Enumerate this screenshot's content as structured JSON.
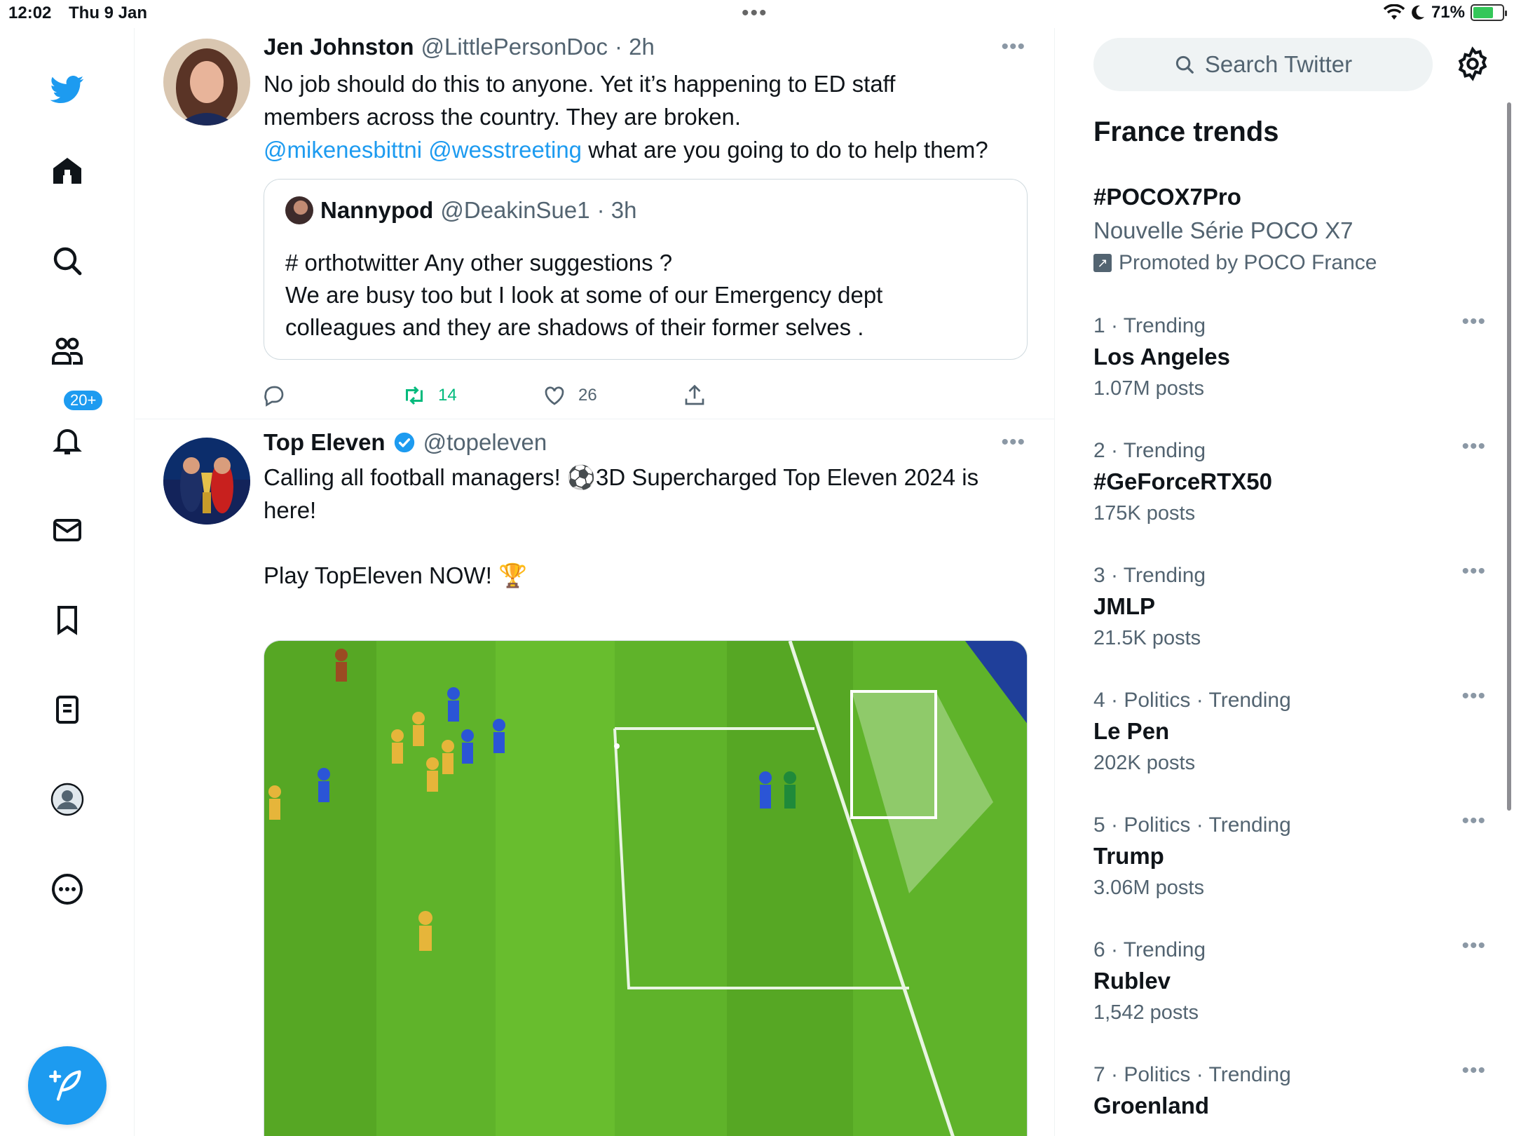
{
  "status_bar": {
    "time": "12:02",
    "date": "Thu 9 Jan",
    "battery": "71%",
    "battery_level": 0.71,
    "icons": [
      "wifi-icon",
      "moon-icon",
      "battery-charging-icon"
    ]
  },
  "nav": {
    "items": [
      "twitter-logo",
      "home",
      "explore",
      "communities",
      "notifications",
      "messages",
      "bookmarks",
      "lists",
      "profile",
      "more"
    ],
    "notifications_badge": "20+",
    "compose_icon": "feather-plus-icon"
  },
  "timeline": {
    "tweets": [
      {
        "name": "Jen Johnston",
        "handle": "@LittlePersonDoc",
        "time": "· 2h",
        "text_line1": "No job should do this to anyone. Yet it’s happening to ED staff",
        "text_line2": "members across the country. They are broken.",
        "mention1": "@mikenesbittni",
        "mention2": "@wesstreeting",
        "text_line3_tail": " what are you going to do to help them?",
        "quote": {
          "name": "Nannypod",
          "handle": "@DeakinSue1",
          "time": "· 3h",
          "line1": "# orthotwitter Any other suggestions ?",
          "line2": "We are busy too but I look at some of our Emergency dept",
          "line3": "colleagues and they are shadows of their former selves ."
        },
        "reply_count": "",
        "retweet_count": "14",
        "like_count": "26"
      },
      {
        "name": "Top Eleven",
        "handle": "@topeleven",
        "verified": true,
        "text_line1": "Calling all football managers! ⚽3D Supercharged Top Eleven 2024 is",
        "text_line2": "here!",
        "text_line3": " Play TopEleven NOW! 🏆"
      }
    ]
  },
  "sidebar": {
    "search_placeholder": "Search Twitter",
    "trends_title": "France trends",
    "promoted": {
      "topic": "#POCOX7Pro",
      "desc": "Nouvelle Série POCO X7",
      "promoted_by": "Promoted by POCO France"
    },
    "trends": [
      {
        "meta": "1 · Trending",
        "topic": "Los Angeles",
        "count": "1.07M posts"
      },
      {
        "meta": "2 · Trending",
        "topic": "#GeForceRTX50",
        "count": "175K posts"
      },
      {
        "meta": "3 · Trending",
        "topic": "JMLP",
        "count": "21.5K posts"
      },
      {
        "meta": "4 · Politics · Trending",
        "topic": "Le Pen",
        "count": "202K posts"
      },
      {
        "meta": "5 · Politics · Trending",
        "topic": "Trump",
        "count": "3.06M posts"
      },
      {
        "meta": "6 · Trending",
        "topic": "Rublev",
        "count": "1,542 posts"
      },
      {
        "meta": "7 · Politics · Trending",
        "topic": "Groenland",
        "count": ""
      }
    ]
  },
  "colors": {
    "accent": "#1d9bf0",
    "retweet": "#00ba7c",
    "text": "#0f1419",
    "muted": "#536471"
  }
}
